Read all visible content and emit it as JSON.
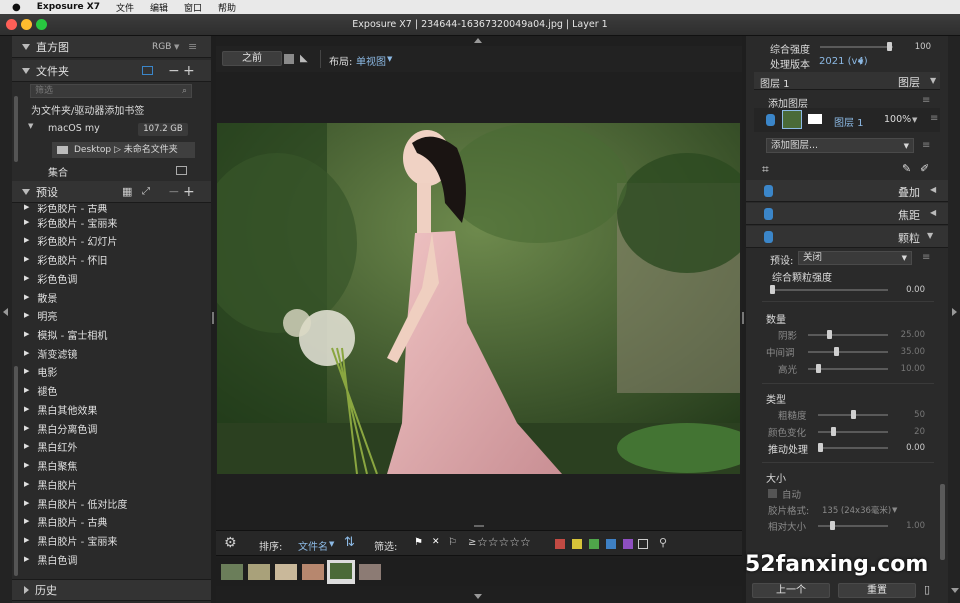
{
  "menubar": {
    "apple": "",
    "app": "Exposure X7",
    "items": [
      "文件",
      "编辑",
      "窗口",
      "帮助"
    ]
  },
  "window": {
    "title": "Exposure X7 | 234644-16367320049a04.jpg | Layer 1"
  },
  "left": {
    "histogram": {
      "title": "直方图",
      "mode": "RGB"
    },
    "folders": {
      "title": "文件夹",
      "filter_placeholder": "筛选",
      "bookmark": "为文件夹/驱动器添加书签",
      "drive": "macOS my",
      "drive_size": "107.2 GB",
      "path": "Desktop ▷ 未命名文件夹",
      "collection": "集合"
    },
    "presets": {
      "title": "预设",
      "items": [
        "彩色胶片 - 古典",
        "彩色胶片 - 宝丽来",
        "彩色胶片 - 幻灯片",
        "彩色胶片 - 怀旧",
        "彩色色调",
        "散景",
        "明亮",
        "模拟 - 富士相机",
        "渐变滤镜",
        "电影",
        "褪色",
        "黑白其他效果",
        "黑白分离色调",
        "黑白红外",
        "黑白聚焦",
        "黑白胶片",
        "黑白胶片 - 低对比度",
        "黑白胶片 - 古典",
        "黑白胶片 - 宝丽来",
        "黑白色调"
      ]
    },
    "history": {
      "title": "历史"
    }
  },
  "center": {
    "before_label": "之前",
    "layout_label": "布局:",
    "layout_value": "单视图",
    "sort_label": "排序:",
    "sort_value": "文件名",
    "filter_label": "筛选:",
    "rating_symbol": "≥"
  },
  "right": {
    "overall_strength": {
      "label": "综合强度",
      "value": "100",
      "level": 0.98
    },
    "version": {
      "label": "处理版本",
      "value": "2021 (v4)"
    },
    "layers": {
      "name": "图层 1",
      "title": "图层",
      "add": "添加图层",
      "layer_label": "图层 1",
      "opacity": "100%",
      "add_dropdown": "添加图层..."
    },
    "sections": [
      "叠加",
      "焦距",
      "颗粒"
    ],
    "grain": {
      "preset_label": "预设:",
      "preset_value": "关闭",
      "overall_label": "综合颗粒强度",
      "overall_value": "0.00",
      "amount_title": "数量",
      "amount": [
        {
          "label": "阴影",
          "value": "25.00",
          "level": 0.25
        },
        {
          "label": "中间调",
          "value": "35.00",
          "level": 0.35
        },
        {
          "label": "高光",
          "value": "10.00",
          "level": 0.1
        }
      ],
      "type_title": "类型",
      "type": [
        {
          "label": "粗糙度",
          "value": "50",
          "level": 0.5
        },
        {
          "label": "颜色变化",
          "value": "20",
          "level": 0.2
        },
        {
          "label": "推动处理",
          "value": "0.00",
          "level": 0.0
        }
      ],
      "size_title": "大小",
      "auto_label": "自动",
      "film_label": "胶片格式:",
      "film_value": "135 (24x36毫米)",
      "rel_label": "相对大小",
      "rel_value": "1.00"
    },
    "footer": {
      "prev": "上一个",
      "reset": "重置"
    }
  },
  "watermark": "52fanxing.com",
  "colors": {
    "accent": "#3b86c9",
    "labels": [
      "#c24a43",
      "#d6c339",
      "#4fa54a",
      "#3e80c4",
      "#8e4fc1"
    ]
  }
}
